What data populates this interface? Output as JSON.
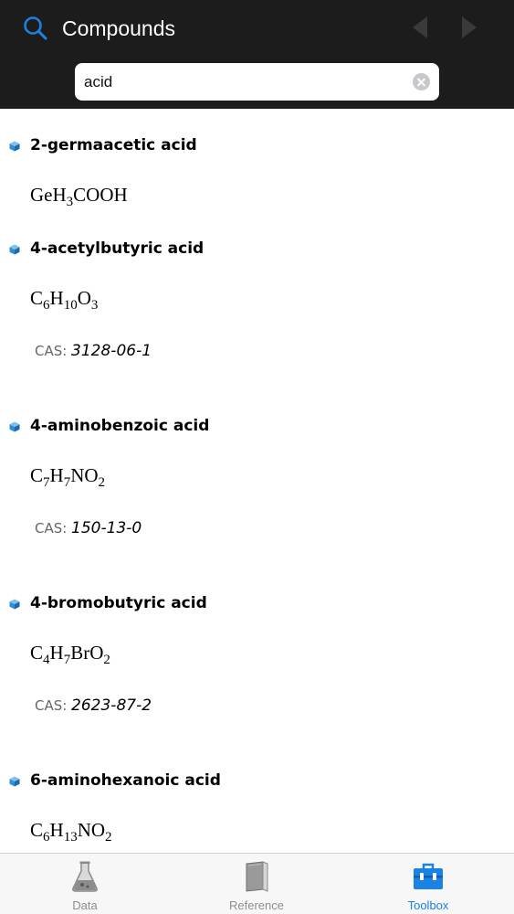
{
  "header": {
    "title": "Compounds",
    "search_value": "acid"
  },
  "compounds": [
    {
      "name": "2-germaacetic acid",
      "formula": [
        [
          "Ge",
          ""
        ],
        [
          "H",
          "3"
        ],
        [
          "COOH",
          ""
        ]
      ],
      "cas_label": "",
      "cas": ""
    },
    {
      "name": "4-acetylbutyric acid",
      "formula": [
        [
          "C",
          "6"
        ],
        [
          "H",
          "10"
        ],
        [
          "O",
          "3"
        ]
      ],
      "cas_label": "CAS:",
      "cas": "3128-06-1"
    },
    {
      "name": "4-aminobenzoic acid",
      "formula": [
        [
          "C",
          "7"
        ],
        [
          "H",
          "7"
        ],
        [
          "NO",
          "2"
        ]
      ],
      "cas_label": "CAS:",
      "cas": "150-13-0"
    },
    {
      "name": "4-bromobutyric acid",
      "formula": [
        [
          "C",
          "4"
        ],
        [
          "H",
          "7"
        ],
        [
          "BrO",
          "2"
        ]
      ],
      "cas_label": "CAS:",
      "cas": "2623-87-2"
    },
    {
      "name": "6-aminohexanoic acid",
      "formula": [
        [
          "C",
          "6"
        ],
        [
          "H",
          "13"
        ],
        [
          "NO",
          "2"
        ]
      ],
      "cas_label": "",
      "cas": ""
    }
  ],
  "tabs": [
    {
      "label": "Data",
      "icon": "flask-icon",
      "active": false
    },
    {
      "label": "Reference",
      "icon": "book-icon",
      "active": false
    },
    {
      "label": "Toolbox",
      "icon": "toolbox-icon",
      "active": true
    }
  ],
  "colors": {
    "header_bg": "#1c1c1c",
    "accent": "#1a82e2",
    "bullet": "#2f8fd0"
  }
}
